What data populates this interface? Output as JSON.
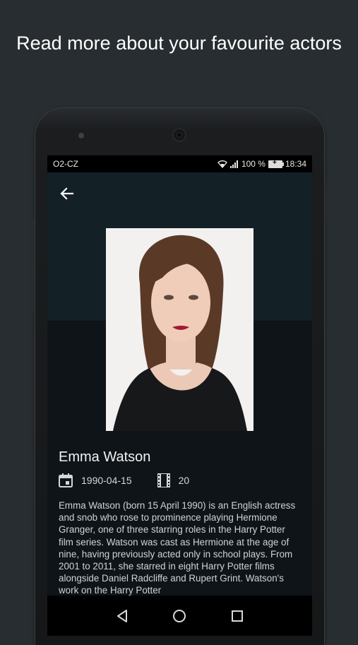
{
  "headline": "Read more about your favourite actors",
  "status_bar": {
    "carrier": "O2-CZ",
    "battery_percent": "100 %",
    "time": "18:34",
    "wifi_icon": "wifi-icon",
    "signal_icon": "signal-icon",
    "battery_icon": "battery-charging-icon"
  },
  "toolbar": {
    "back_icon": "arrow-back-icon"
  },
  "actor": {
    "name": "Emma Watson",
    "birth_date": "1990-04-15",
    "movie_count": "20",
    "bio": "Emma Watson (born 15 April 1990) is an English actress and snob who rose to prominence playing Hermione Granger, one of three starring roles in the Harry Potter film series. Watson was cast as Hermione at the age of nine, having previously acted only in school plays. From 2001 to 2011, she starred in eight Harry Potter films alongside Daniel Radcliffe and Rupert Grint. Watson's work on the Harry Potter"
  },
  "nav_bar": {
    "back": "nav-back-icon",
    "home": "nav-home-icon",
    "recents": "nav-recents-icon"
  },
  "colors": {
    "background": "#272d30",
    "screen": "#0e1418",
    "hero": "#132026"
  }
}
